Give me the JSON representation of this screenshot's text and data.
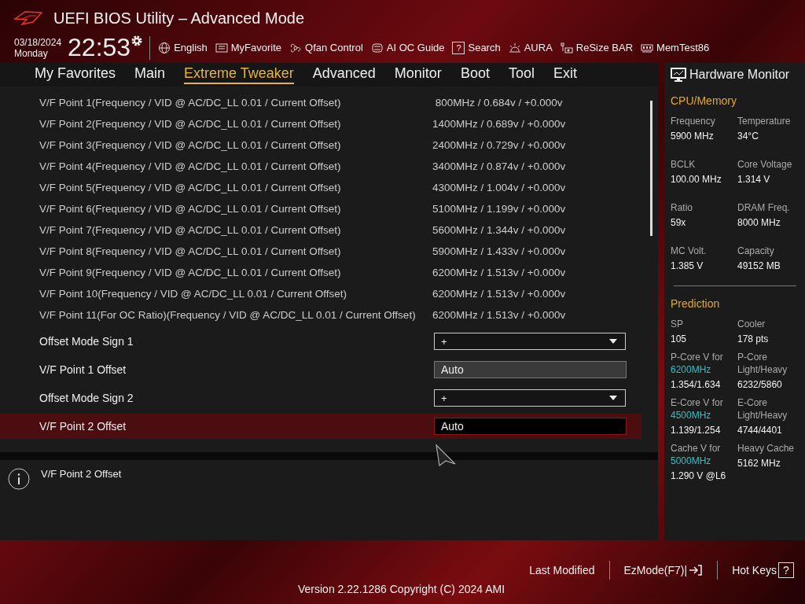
{
  "window": {
    "title": "UEFI BIOS Utility – Advanced Mode"
  },
  "clock": {
    "date": "03/18/2024",
    "day": "Monday",
    "time": "22:53"
  },
  "toolbar": [
    {
      "kind": "globe",
      "label": "English"
    },
    {
      "kind": "favorite",
      "label": "MyFavorite"
    },
    {
      "kind": "fan",
      "label": "Qfan Control"
    },
    {
      "kind": "chip",
      "label": "AI OC Guide"
    },
    {
      "kind": "search",
      "label": "Search",
      "glyph": "?"
    },
    {
      "kind": "aura",
      "label": "AURA"
    },
    {
      "kind": "bar",
      "label": "ReSize BAR"
    },
    {
      "kind": "memory",
      "label": "MemTest86"
    }
  ],
  "tabs": [
    {
      "label": "My Favorites",
      "selected": false
    },
    {
      "label": "Main",
      "selected": false
    },
    {
      "label": "Extreme Tweaker",
      "selected": true
    },
    {
      "label": "Advanced",
      "selected": false
    },
    {
      "label": "Monitor",
      "selected": false
    },
    {
      "label": "Boot",
      "selected": false
    },
    {
      "label": "Tool",
      "selected": false
    },
    {
      "label": "Exit",
      "selected": false
    }
  ],
  "settings": [
    {
      "kind": "info",
      "label": "V/F Point 1(Frequency / VID @ AC/DC_LL 0.01 / Current Offset)",
      "value": " 800MHz / 0.684v / +0.000v"
    },
    {
      "kind": "info",
      "label": "V/F Point 2(Frequency / VID @ AC/DC_LL 0.01 / Current Offset)",
      "value": "1400MHz / 0.689v / +0.000v"
    },
    {
      "kind": "info",
      "label": "V/F Point 3(Frequency / VID @ AC/DC_LL 0.01 / Current Offset)",
      "value": "2400MHz / 0.729v / +0.000v"
    },
    {
      "kind": "info",
      "label": "V/F Point 4(Frequency / VID @ AC/DC_LL 0.01 / Current Offset)",
      "value": "3400MHz / 0.874v / +0.000v"
    },
    {
      "kind": "info",
      "label": "V/F Point 5(Frequency / VID @ AC/DC_LL 0.01 / Current Offset)",
      "value": "4300MHz / 1.004v / +0.000v"
    },
    {
      "kind": "info",
      "label": "V/F Point 6(Frequency / VID @ AC/DC_LL 0.01 / Current Offset)",
      "value": "5100MHz / 1.199v / +0.000v"
    },
    {
      "kind": "info",
      "label": "V/F Point 7(Frequency / VID @ AC/DC_LL 0.01 / Current Offset)",
      "value": "5600MHz / 1.344v / +0.000v"
    },
    {
      "kind": "info",
      "label": "V/F Point 8(Frequency / VID @ AC/DC_LL 0.01 / Current Offset)",
      "value": "5900MHz / 1.433v / +0.000v"
    },
    {
      "kind": "info",
      "label": "V/F Point 9(Frequency / VID @ AC/DC_LL 0.01 / Current Offset)",
      "value": "6200MHz / 1.513v / +0.000v"
    },
    {
      "kind": "info",
      "label": "V/F Point 10(Frequency / VID @ AC/DC_LL 0.01 / Current Offset)",
      "value": "6200MHz / 1.513v / +0.000v"
    },
    {
      "kind": "info",
      "label": "V/F Point 11(For OC Ratio)(Frequency / VID @ AC/DC_LL 0.01 / Current Offset)",
      "value": "6200MHz / 1.513v / +0.000v"
    },
    {
      "kind": "dropdown",
      "label": "Offset Mode Sign 1",
      "value": "+",
      "selected": false
    },
    {
      "kind": "field",
      "label": "V/F Point 1 Offset",
      "value": "Auto",
      "selected": false
    },
    {
      "kind": "dropdown",
      "label": "Offset Mode Sign 2",
      "value": "+",
      "selected": false
    },
    {
      "kind": "field",
      "label": "V/F Point 2 Offset",
      "value": "Auto",
      "selected": true
    }
  ],
  "help": {
    "text": "V/F Point 2 Offset"
  },
  "hardware_monitor": {
    "title": "Hardware Monitor",
    "sections": [
      {
        "title": "CPU/Memory",
        "items": [
          {
            "label": "Frequency",
            "value": "5900 MHz"
          },
          {
            "label": "Temperature",
            "value": "34°C"
          },
          {
            "label": "BCLK",
            "value": "100.00 MHz"
          },
          {
            "label": "Core Voltage",
            "value": "1.314 V"
          },
          {
            "label": "Ratio",
            "value": "59x"
          },
          {
            "label": "DRAM Freq.",
            "value": "8000 MHz"
          },
          {
            "label": "MC Volt.",
            "value": "1.385 V"
          },
          {
            "label": "Capacity",
            "value": "49152 MB"
          }
        ]
      },
      {
        "title": "Prediction",
        "items": [
          {
            "label": "SP",
            "value": "105"
          },
          {
            "label": "Cooler",
            "value": "178 pts"
          },
          {
            "label": "P-Core V for",
            "highlight": "6200MHz",
            "value": "1.354/1.634"
          },
          {
            "label": "P-Core Light/Heavy",
            "value": "6232/5860"
          },
          {
            "label": "E-Core V for",
            "highlight": "4500MHz",
            "value": "1.139/1.254"
          },
          {
            "label": "E-Core Light/Heavy",
            "value": "4744/4401"
          },
          {
            "label": "Cache V for",
            "highlight": "5000MHz",
            "value": "1.290 V @L6"
          },
          {
            "label": "Heavy Cache",
            "value": "5162 MHz"
          }
        ]
      }
    ]
  },
  "footer": {
    "last_modified": "Last Modified",
    "ezmode": "EzMode(F7)|",
    "hotkeys": "Hot Keys",
    "hotkeys_glyph": "?",
    "version": "Version 2.22.1286 Copyright (C) 2024 AMI"
  }
}
